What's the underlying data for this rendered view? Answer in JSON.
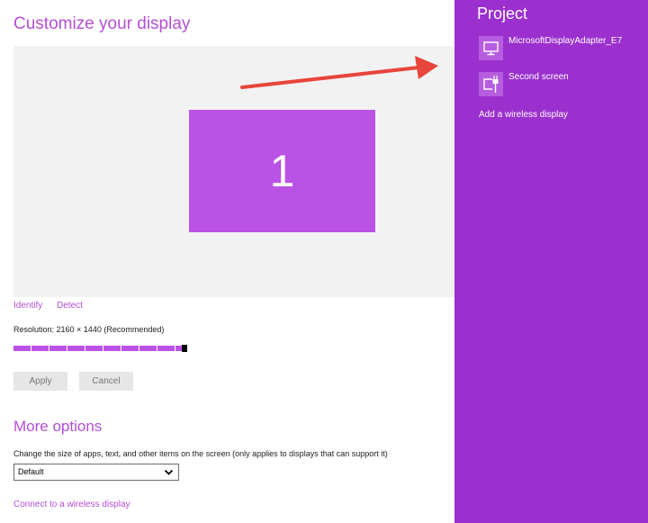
{
  "main": {
    "title": "Customize your display",
    "monitor_number": "1",
    "links": {
      "identify": "Identify",
      "detect": "Detect"
    },
    "resolution_label": "Resolution: 2160 × 1440 (Recommended)",
    "resolution_slider_level": 0.97,
    "buttons": {
      "apply": "Apply",
      "cancel": "Cancel"
    },
    "more_options": {
      "title": "More options",
      "description": "Change the size of apps, text, and other items on the screen (only applies to displays that can support it)",
      "size_select_value": "Default",
      "connect_link": "Connect to a wireless display"
    }
  },
  "panel": {
    "title": "Project",
    "devices": [
      {
        "label": "MicrosoftDisplayAdapter_E7",
        "icon": "monitor-icon"
      },
      {
        "label": "Second screen",
        "icon": "second-screen-icon"
      }
    ],
    "add_wireless": "Add a wireless display"
  },
  "colors": {
    "accent": "#b44fd6",
    "monitor": "#bb52e6",
    "panel": "#9b30cf",
    "arrow": "#e8453c"
  }
}
